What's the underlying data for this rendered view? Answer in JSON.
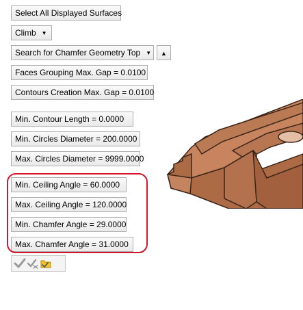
{
  "buttons": {
    "select_all": "Select All Displayed Surfaces",
    "direction": "Climb",
    "search_mode": "Search for Chamfer Geometry Top",
    "faces_gap": "Faces Grouping Max. Gap =  0.0100",
    "contours_gap": "Contours Creation Max. Gap =  0.0100",
    "min_contour": "Min. Contour Length =  0.0000",
    "min_circles": "Min. Circles Diameter = 200.0000",
    "max_circles": "Max. Circles Diameter = 9999.0000",
    "min_ceiling": "Min. Ceiling Angle = 60.0000",
    "max_ceiling": "Max. Ceiling Angle = 120.0000",
    "min_chamfer": "Min. Chamfer Angle = 29.0000",
    "max_chamfer": "Max. Chamfer Angle = 31.0000"
  },
  "icons": {
    "up": "triangle-up-icon",
    "ok": "checkmark-icon",
    "apply": "apply-check-icon",
    "folder": "folder-icon"
  },
  "colors": {
    "highlight": "#d6142b",
    "model": "#c07a55"
  }
}
